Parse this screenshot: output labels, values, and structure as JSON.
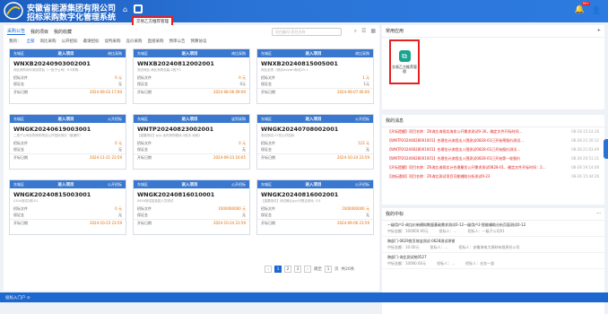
{
  "header": {
    "title_line1": "安徽省能源集团有限公司",
    "title_line2": "招标采购数字化管理系统",
    "tooltip": "交易乙方推荐管理",
    "badge": "99+"
  },
  "tabs": [
    "采购公告",
    "我的项目",
    "我的收藏"
  ],
  "search": {
    "placeholder": "项目编号/项目名称"
  },
  "filter": [
    "我的：",
    "全部",
    "询比采购",
    "公开招标",
    "邀请招标",
    "谈判采购",
    "竞价采购",
    "直接采购",
    "预审公告",
    "预算协议"
  ],
  "cards": [
    {
      "region": "东城区",
      "status": "进入项目",
      "type": "询比采购",
      "no": "WNXB20240903002001",
      "sub": "询比采购询价测试项目（一批子公司）9-3采购…",
      "f1": "招标文件",
      "v1": "0 元",
      "f2": "保证金",
      "v2": "无",
      "f3": "开标日期",
      "v3": "2024-09-03 17:00"
    },
    {
      "region": "东城区",
      "status": "进入项目",
      "type": "询比采购",
      "no": "WNXB20240812002001",
      "sub": "测试询比-询比采购包装-2批下1",
      "f1": "招标文件",
      "v1": "0 元",
      "f2": "保证金",
      "v2": "0元",
      "f3": "开标日期",
      "v3": "2024-08-06 09:00"
    },
    {
      "region": "东城区",
      "status": "进入项目",
      "type": "询比采购",
      "no": "WNXB20240815005001",
      "sub": "询比全项（测试shiyishi标包15-1",
      "f1": "招标文件",
      "v1": "1 元",
      "f2": "保证金",
      "v2": "1元",
      "f3": "开标日期",
      "v3": "2024-09-07 00:00"
    },
    {
      "region": "东城区",
      "status": "进入项目",
      "type": "公开招标",
      "no": "WNGK20240619003001",
      "sub": "二类子公司实物采购项目公开招标测试（普通件）",
      "f1": "招标文件",
      "v1": "0 元",
      "f2": "保证金",
      "v2": "无",
      "f3": "开标日期",
      "v3": "2024-11-21 23:59"
    },
    {
      "region": "东城区",
      "status": "进入项目",
      "type": "谈判采购",
      "no": "WNTP20240823002001",
      "sub": "【重要测试】gyy-谈判采购程序-2批次-标段1",
      "f1": "招标文件",
      "v1": "0 元",
      "f2": "保证金",
      "v2": "无",
      "f3": "开标日期",
      "v3": "2024-09-23 16:05"
    },
    {
      "region": "东城区",
      "status": "进入项目",
      "type": "公开招标",
      "no": "WNGK20240708002001",
      "sub": "测试测试-07初公开招标",
      "f1": "招标文件",
      "v1": "123 元",
      "f2": "保证金",
      "v2": "无",
      "f3": "开标日期",
      "v3": "2024-10-24 23:59"
    },
    {
      "region": "东城区",
      "status": "进入项目",
      "type": "公开招标",
      "no": "WNGK20240815003001",
      "sub": "0304测试2期-01",
      "f1": "招标文件",
      "v1": "0 元",
      "f2": "保证金",
      "v2": "无",
      "f3": "开标日期",
      "v3": "2024-10-23 23:59"
    },
    {
      "region": "东城区",
      "status": "进入项目",
      "type": "公开招标",
      "no": "WNGK20240816010001",
      "sub": "0816测试招投招人员测试",
      "f1": "招标文件",
      "v1": "1000000000 元",
      "f2": "保证金",
      "v2": "无",
      "f3": "开标日期",
      "v3": "2024-10-24 23:59"
    },
    {
      "region": "东城区",
      "status": "进入项目",
      "type": "公开招标",
      "no": "WNGK20240816002001",
      "sub": "【重要测试】测试确认gyy可是否改动（01",
      "f1": "招标文件",
      "v1": "1000000000 元",
      "f2": "保证金",
      "v2": "无",
      "f3": "开标日期",
      "v3": "2024-09-06 23:59"
    }
  ],
  "pager": {
    "pages": [
      "1",
      "2",
      "3"
    ],
    "goto": "跳至",
    "page_unit": "页",
    "total": "共20条"
  },
  "common": {
    "title": "常用应用",
    "add": "+",
    "app_label": "交易乙方推荐管理"
  },
  "messages": {
    "title": "我的消息",
    "items": [
      {
        "text": "【开标提醒】项目名称：ZK询比询现实海发公开需求测试9-30，确定文件开标时间…",
        "date": "08-18 15:14:16"
      },
      {
        "text": "【WNTP20240828001001】合理估计流程出入围测试0828-01已开始预报价测试…",
        "date": "08-28 21:20:12"
      },
      {
        "text": "【WNTP20240828001001】合理估计流程出入围测试0828-01已开始报价测试…",
        "date": "08-28 21:03:49"
      },
      {
        "text": "【WNTP20240828001001】合理估计流程出入围测试0828-01已开始第一轮报价",
        "date": "08-28 20:51:11"
      },
      {
        "text": "【开标提醒】项目名称：ZK询比询现实计合理最优公开需求测试0828-01，确定文件开标时间：2…",
        "date": "08-28 19:14:08"
      },
      {
        "text": "【流标通知】项目名称：ZK询比测试项目可能辅助分析测试9-23",
        "date": "08-26 15:44:26"
      }
    ]
  },
  "wins": {
    "title": "我的中标",
    "items": [
      {
        "t": "一级用户2-询比价新模拟数量基础需求测试0-12—级用户2-智能辅助分析页面测试0-12",
        "amt": "中标金额：100000.00元",
        "who": "投标人：…",
        "unit": "招标人：一级子公司01"
      },
      {
        "t": "跨部门-0629首页效益测试-0628测试承销",
        "amt": "中标金额：10.00元",
        "who": "投标人：…",
        "unit": "招标人：安徽海电力源材有限责任公司"
      },
      {
        "t": "跨部门-询比测试统0527",
        "amt": "中标金额：10000.00元",
        "who": "投标人：…",
        "unit": "招标人：业务一部"
      }
    ]
  },
  "footer": {
    "label": "投标入门户 ⊙"
  }
}
